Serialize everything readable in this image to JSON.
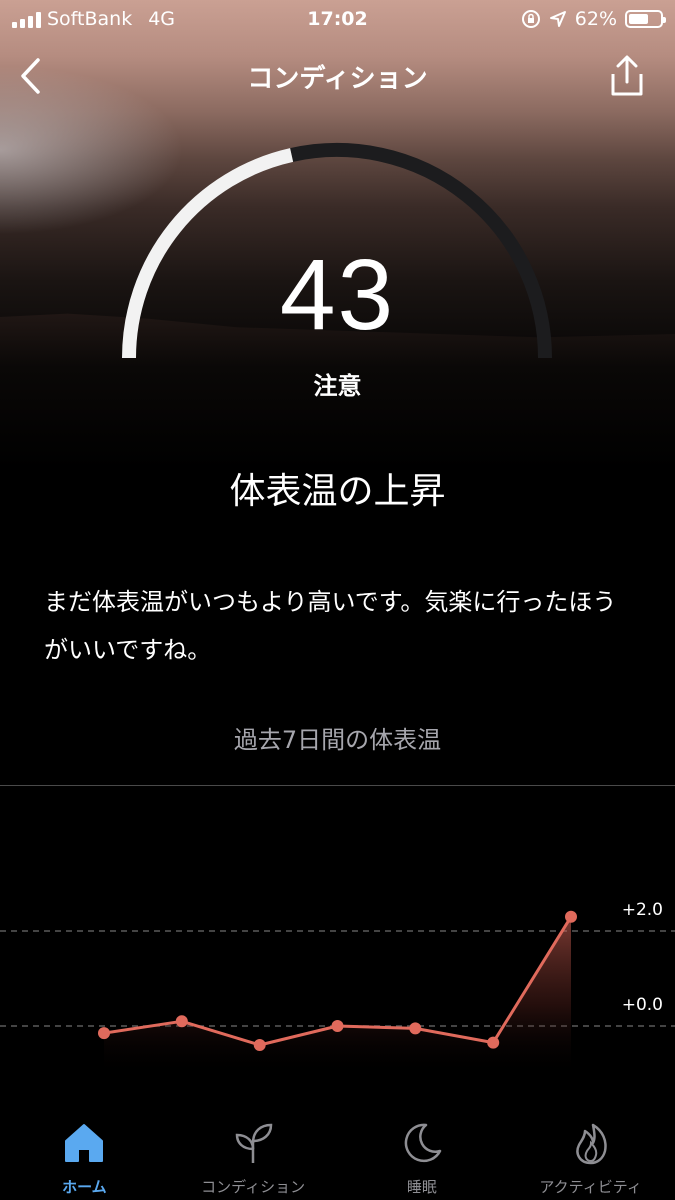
{
  "status_bar": {
    "carrier": "SoftBank",
    "network": "4G",
    "time": "17:02",
    "battery": "62%",
    "battery_level": 0.62
  },
  "nav": {
    "title": "コンディション",
    "back_icon": "chevron-left-icon",
    "share_icon": "share-icon"
  },
  "gauge": {
    "score": "43",
    "status": "注意",
    "progress": 0.43
  },
  "headline": "体表温の上昇",
  "description": "まだ体表温がいつもより高いです。気楽に行ったほうがいいですね。",
  "chart_section": {
    "title": "過去7日間の体表温"
  },
  "chart_data": {
    "type": "line",
    "title": "",
    "xlabel": "",
    "ylabel": "",
    "y_tick_labels": [
      "+2.0",
      "+0.0"
    ],
    "y_ticks": [
      2.0,
      0.0
    ],
    "ylim": [
      -1.0,
      4.5
    ],
    "grid": true,
    "series": [
      {
        "values": [
          -0.15,
          0.1,
          -0.4,
          0.0,
          -0.05,
          -0.35,
          2.3
        ]
      }
    ],
    "line_color": "#e06a5c"
  },
  "tabs": [
    {
      "label": "ホーム",
      "icon": "home-icon",
      "active": true
    },
    {
      "label": "コンディション",
      "icon": "sprout-icon",
      "active": false
    },
    {
      "label": "睡眠",
      "icon": "moon-icon",
      "active": false
    },
    {
      "label": "アクティビティ",
      "icon": "flame-icon",
      "active": false
    }
  ],
  "colors": {
    "accent": "#5aa9f0",
    "chart_line": "#e06a5c",
    "gauge_fill": "#f2f2f2",
    "gauge_track": "#1c1c1e"
  }
}
